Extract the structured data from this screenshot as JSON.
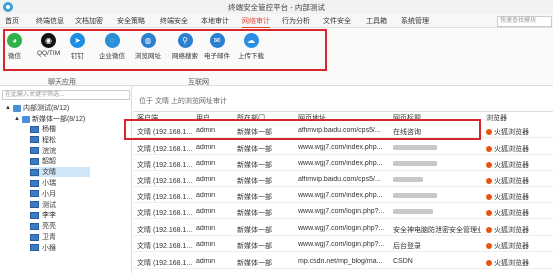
{
  "window": {
    "title": "终端安全管控平台 - 内部测试"
  },
  "menu": [
    {
      "label": "首页",
      "active": false
    },
    {
      "label": "终端信息",
      "active": false
    },
    {
      "label": "文档加密",
      "active": false
    },
    {
      "label": "安全策略",
      "active": false
    },
    {
      "label": "终端安全",
      "active": false
    },
    {
      "label": "本地审计",
      "active": false
    },
    {
      "label": "网络审计",
      "active": true
    },
    {
      "label": "行为分析",
      "active": false
    },
    {
      "label": "文件安全",
      "active": false
    },
    {
      "label": "工具箱",
      "active": false
    },
    {
      "label": "系统管理",
      "active": false
    }
  ],
  "search": {
    "placeholder": "快速查找模块"
  },
  "ribbon": {
    "tools": [
      {
        "label": "微信",
        "icon": "wechat-icon",
        "color": "#2fb24b",
        "glyph": "◕"
      },
      {
        "label": "QQ/TIM",
        "icon": "qq-icon",
        "color": "#111111",
        "glyph": "◉"
      },
      {
        "label": "钉钉",
        "icon": "dingtalk-icon",
        "color": "#1c8fe4",
        "glyph": "➤"
      },
      {
        "label": "企业微信",
        "icon": "wecom-icon",
        "color": "#2a8fd6",
        "glyph": "◌"
      },
      {
        "label": "浏览网址",
        "icon": "globe-icon",
        "color": "#2a7fd0",
        "glyph": "◍",
        "selected": true
      },
      {
        "label": "网络搜索",
        "icon": "search-icon",
        "color": "#2a7fd0",
        "glyph": "⚲"
      },
      {
        "label": "电子邮件",
        "icon": "email-icon",
        "color": "#2a7fd0",
        "glyph": "✉"
      },
      {
        "label": "上传下载",
        "icon": "cloud-icon",
        "color": "#2a8fe4",
        "glyph": "☁"
      }
    ],
    "groups": [
      "聊天应用",
      "互联网"
    ]
  },
  "sidebar": {
    "filter_placeholder": "在此输入关键字筛选...",
    "root": "内部测试(8/12)",
    "group": "新媒体一部(8/12)",
    "items": [
      "杨楷",
      "程松",
      "浣浣",
      "韶韶",
      "文晴",
      "小瑞",
      "小月",
      "测试",
      "李李",
      "亮亮",
      "卫青",
      "小猴"
    ],
    "selected_index": 4
  },
  "content": {
    "title": "位于 文晴 上的浏览网址审计",
    "columns": [
      "客户端",
      "用户",
      "所在部门",
      "网页地址",
      "网页标题",
      "浏览器"
    ],
    "rows": [
      {
        "client": "文晴 (192.168.1...",
        "user": "admin",
        "dept": "新媒体一部",
        "url": "affimvip.baidu.com/cps5/...",
        "title": "在线咨询",
        "title_blur": 0,
        "browser": "火狐浏览器"
      },
      {
        "client": "文晴 (192.168.1...",
        "user": "admin",
        "dept": "新媒体一部",
        "url": "www.wgj7.com/index.php...",
        "title": "",
        "title_blur": 44,
        "browser": "火狐浏览器"
      },
      {
        "client": "文晴 (192.168.1...",
        "user": "admin",
        "dept": "新媒体一部",
        "url": "www.wgj7.com/index.php...",
        "title": "",
        "title_blur": 44,
        "browser": "火狐浏览器"
      },
      {
        "client": "文晴 (192.168.1...",
        "user": "admin",
        "dept": "新媒体一部",
        "url": "affimvip.baidu.com/cps5/...",
        "title": "",
        "title_blur": 30,
        "browser": "火狐浏览器"
      },
      {
        "client": "文晴 (192.168.1...",
        "user": "admin",
        "dept": "新媒体一部",
        "url": "www.wgj7.com/index.php...",
        "title": "",
        "title_blur": 44,
        "browser": "火狐浏览器"
      },
      {
        "client": "文晴 (192.168.1...",
        "user": "admin",
        "dept": "新媒体一部",
        "url": "www.wgj7.com/login.php?...",
        "title": "",
        "title_blur": 40,
        "browser": "火狐浏览器"
      },
      {
        "client": "文晴 (192.168.1...",
        "user": "admin",
        "dept": "新媒体一部",
        "url": "www.wgj7.com/login.php?...",
        "title": "安全神电脑防泄密安全管理业...",
        "title_blur": 0,
        "browser": "火狐浏览器"
      },
      {
        "client": "文晴 (192.168.1...",
        "user": "admin",
        "dept": "新媒体一部",
        "url": "www.wgj7.com/login.php?...",
        "title": "后台登录",
        "title_blur": 0,
        "browser": "火狐浏览器"
      },
      {
        "client": "文晴 (192.168.1...",
        "user": "admin",
        "dept": "新媒体一部",
        "url": "mp.csdn.net/mp_blog/ma...",
        "title": "CSDN",
        "title_blur": 0,
        "browser": "火狐浏览器"
      }
    ]
  },
  "colors": {
    "accent": "#e04a3a",
    "highlight": "#d9262c",
    "selection": "#cde6f7"
  }
}
